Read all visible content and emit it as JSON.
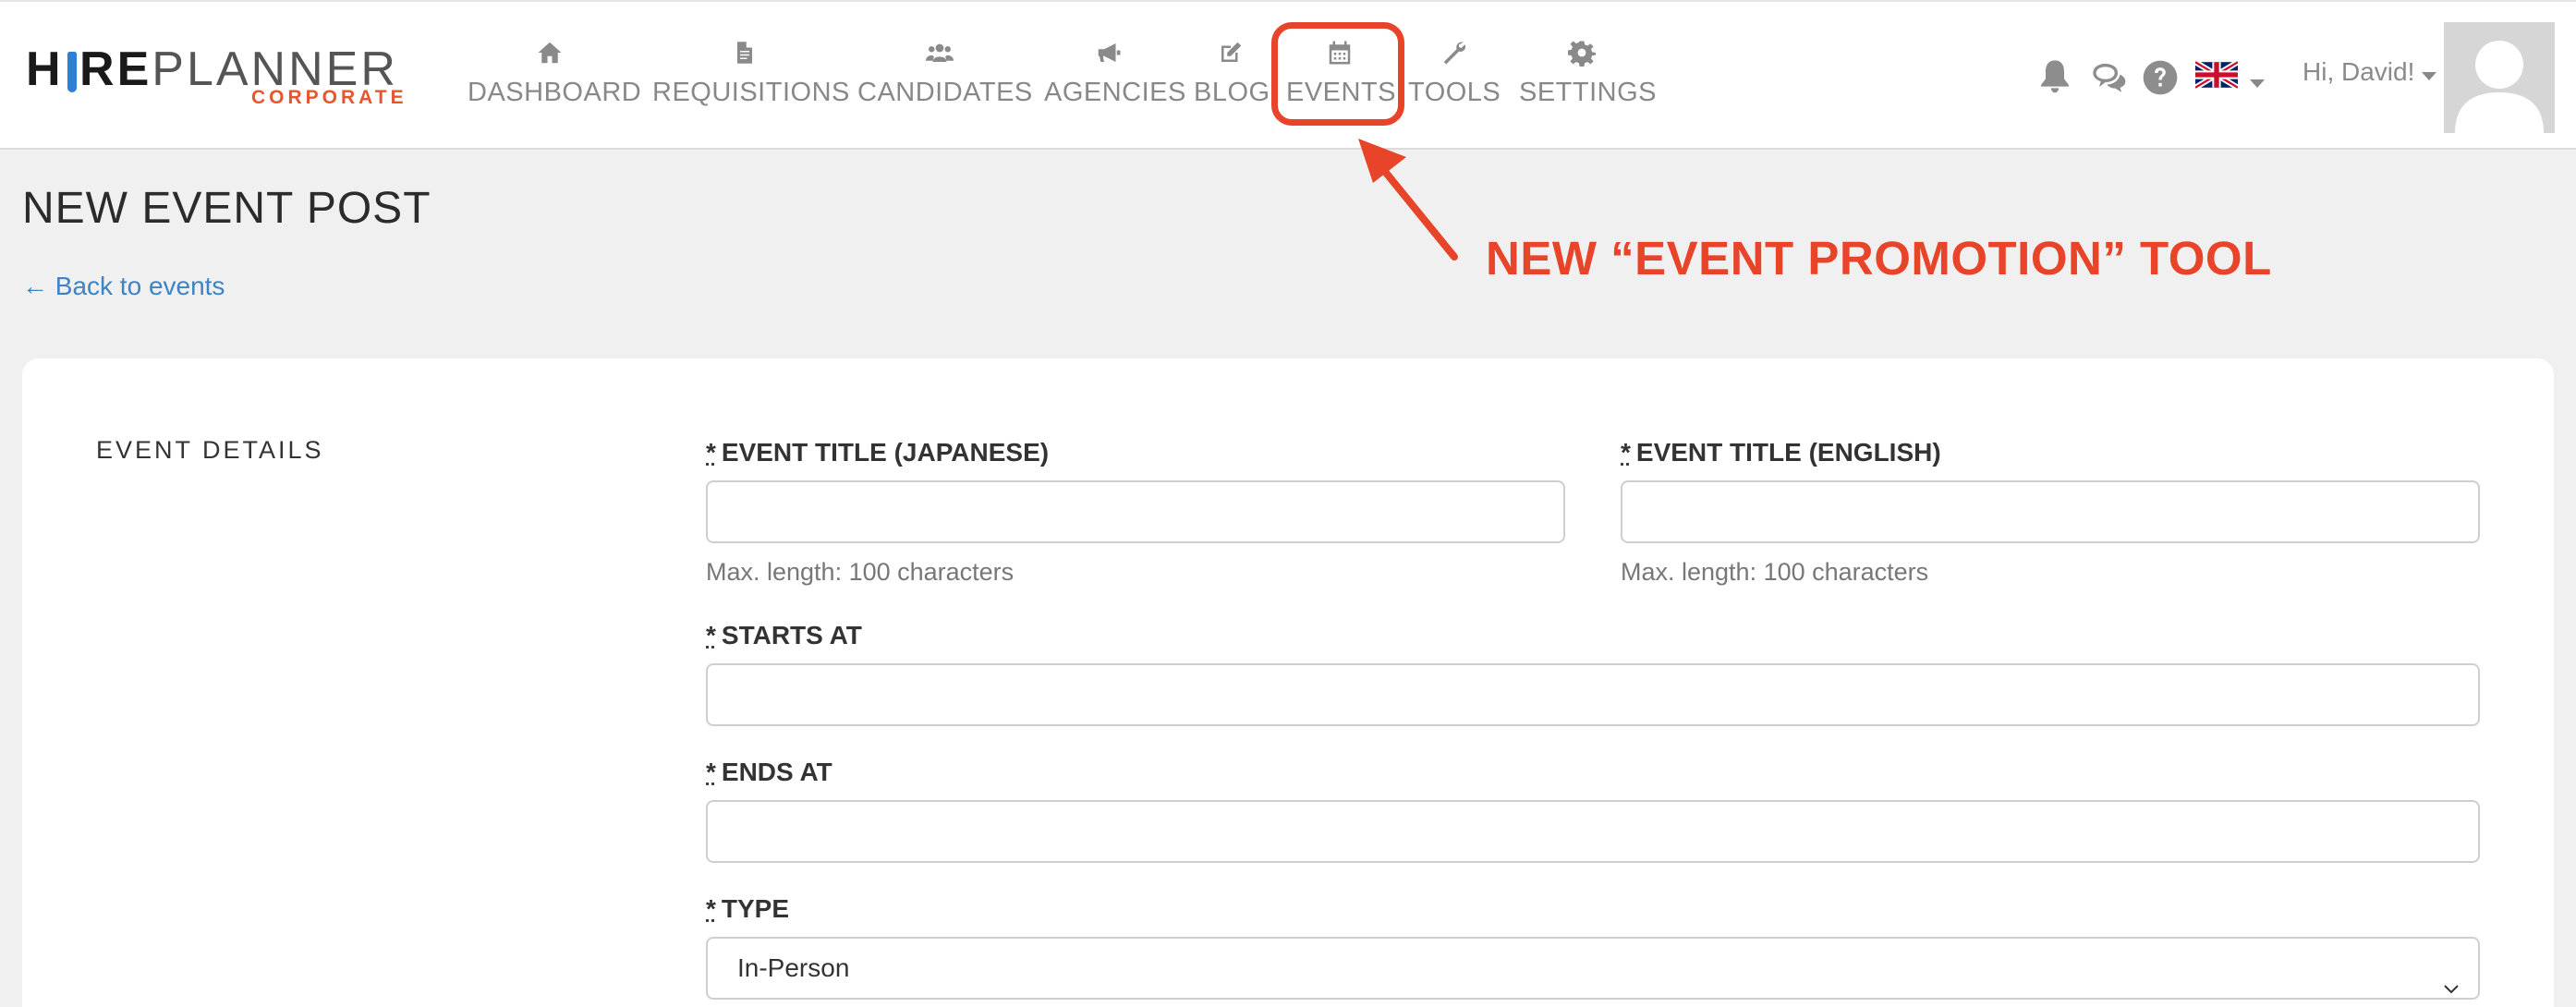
{
  "logo": {
    "part_bold_1": "H",
    "part_i": "i",
    "part_bold_2": "RE",
    "part_light": "PLANNER",
    "sub": "CORPORATE"
  },
  "nav": {
    "items": [
      {
        "label": "DASHBOARD",
        "icon": "home-icon"
      },
      {
        "label": "REQUISITIONS",
        "icon": "document-icon"
      },
      {
        "label": "CANDIDATES",
        "icon": "users-icon"
      },
      {
        "label": "AGENCIES",
        "icon": "megaphone-icon"
      },
      {
        "label": "BLOG",
        "icon": "edit-icon"
      },
      {
        "label": "EVENTS",
        "icon": "calendar-icon",
        "highlighted": true
      },
      {
        "label": "TOOLS",
        "icon": "wrench-icon"
      },
      {
        "label": "SETTINGS",
        "icon": "gear-icon"
      }
    ]
  },
  "header_right": {
    "icons": [
      "bell-icon",
      "chat-icon",
      "help-icon",
      "uk-flag-icon"
    ],
    "greeting": "Hi, David!"
  },
  "page": {
    "title": "NEW EVENT POST",
    "back_link": "← Back to events"
  },
  "annotation": {
    "text": "NEW “EVENT PROMOTION” TOOL",
    "color": "#e8442a"
  },
  "form": {
    "section_label": "EVENT DETAILS",
    "required_marker": "*",
    "title_ja": {
      "label": "EVENT TITLE (JAPANESE)",
      "value": "",
      "help": "Max. length: 100 characters"
    },
    "title_en": {
      "label": "EVENT TITLE (ENGLISH)",
      "value": "",
      "help": "Max. length: 100 characters"
    },
    "starts_at": {
      "label": "STARTS AT",
      "value": ""
    },
    "ends_at": {
      "label": "ENDS AT",
      "value": ""
    },
    "type": {
      "label": "TYPE",
      "selected": "In-Person"
    }
  },
  "colors": {
    "accent_red": "#e8442a",
    "link_blue": "#3c84c4",
    "logo_orange": "#e7562d",
    "logo_tie_blue": "#2f7fd3"
  }
}
